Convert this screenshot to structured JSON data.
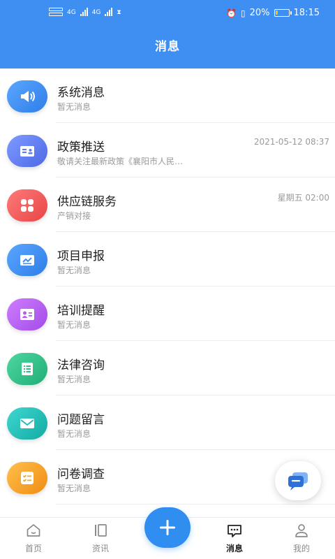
{
  "status_bar": {
    "battery": "20%",
    "time": "18:15",
    "battery_level": 0.2
  },
  "header": {
    "title": "消息"
  },
  "messages": [
    {
      "title": "系统消息",
      "subtitle": "暂无消息",
      "time": "",
      "icon": "megaphone-icon",
      "color": "#3f8ff2"
    },
    {
      "title": "政策推送",
      "subtitle": "敬请关注最新政策《襄阳市人民…",
      "time": "2021-05-12 08:37",
      "icon": "id-card-icon",
      "color": "#5b7cf0"
    },
    {
      "title": "供应链服务",
      "subtitle": "产销对接",
      "time": "星期五 02:00",
      "icon": "grid-icon",
      "color": "#f05a5a"
    },
    {
      "title": "项目申报",
      "subtitle": "暂无消息",
      "time": "",
      "icon": "form-icon",
      "color": "#3f8ff2"
    },
    {
      "title": "培训提醒",
      "subtitle": "暂无消息",
      "time": "",
      "icon": "profile-card-icon",
      "color": "#b45ef0"
    },
    {
      "title": "法律咨询",
      "subtitle": "暂无消息",
      "time": "",
      "icon": "list-icon",
      "color": "#2fc08a"
    },
    {
      "title": "问题留言",
      "subtitle": "暂无消息",
      "time": "",
      "icon": "mail-icon",
      "color": "#1fc0b8"
    },
    {
      "title": "问卷调查",
      "subtitle": "暂无消息",
      "time": "",
      "icon": "checklist-icon",
      "color": "#f5a623"
    }
  ],
  "bottom_nav": {
    "items": [
      {
        "label": "首页",
        "icon": "home-icon"
      },
      {
        "label": "资讯",
        "icon": "news-icon"
      },
      {
        "label": "",
        "icon": "plus-icon"
      },
      {
        "label": "消息",
        "icon": "message-icon"
      },
      {
        "label": "我的",
        "icon": "user-icon"
      }
    ],
    "active_index": 3
  },
  "colors": {
    "primary": "#3f8ff2",
    "add_button": "#2f8ef0"
  }
}
